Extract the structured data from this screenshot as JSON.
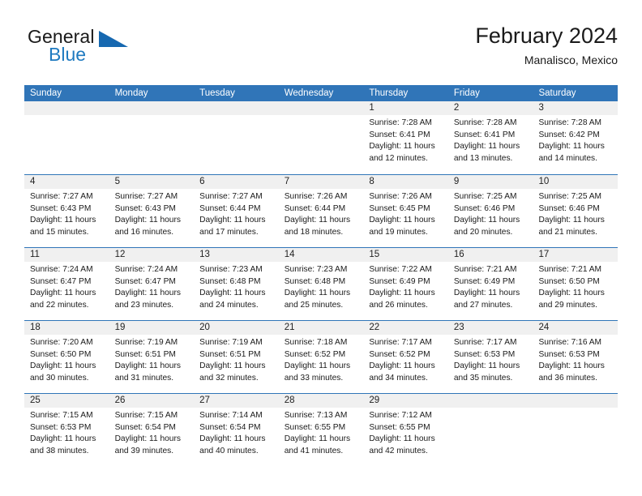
{
  "brand": {
    "name_top": "General",
    "name_bottom": "Blue",
    "triangle_color": "#1668b0",
    "blue_text_color": "#1f7ac0"
  },
  "header": {
    "title": "February 2024",
    "subtitle": "Manalisco, Mexico"
  },
  "theme": {
    "header_blue": "#3075b8",
    "day_band_gray": "#f0f0f0",
    "row_divider_blue": "#3075b8",
    "text_color": "#1a1a1a"
  },
  "weekdays": [
    "Sunday",
    "Monday",
    "Tuesday",
    "Wednesday",
    "Thursday",
    "Friday",
    "Saturday"
  ],
  "weeks": [
    [
      {
        "day": "",
        "empty": true
      },
      {
        "day": "",
        "empty": true
      },
      {
        "day": "",
        "empty": true
      },
      {
        "day": "",
        "empty": true
      },
      {
        "day": "1",
        "sunrise": "Sunrise: 7:28 AM",
        "sunset": "Sunset: 6:41 PM",
        "daylight_1": "Daylight: 11 hours",
        "daylight_2": "and 12 minutes."
      },
      {
        "day": "2",
        "sunrise": "Sunrise: 7:28 AM",
        "sunset": "Sunset: 6:41 PM",
        "daylight_1": "Daylight: 11 hours",
        "daylight_2": "and 13 minutes."
      },
      {
        "day": "3",
        "sunrise": "Sunrise: 7:28 AM",
        "sunset": "Sunset: 6:42 PM",
        "daylight_1": "Daylight: 11 hours",
        "daylight_2": "and 14 minutes."
      }
    ],
    [
      {
        "day": "4",
        "sunrise": "Sunrise: 7:27 AM",
        "sunset": "Sunset: 6:43 PM",
        "daylight_1": "Daylight: 11 hours",
        "daylight_2": "and 15 minutes."
      },
      {
        "day": "5",
        "sunrise": "Sunrise: 7:27 AM",
        "sunset": "Sunset: 6:43 PM",
        "daylight_1": "Daylight: 11 hours",
        "daylight_2": "and 16 minutes."
      },
      {
        "day": "6",
        "sunrise": "Sunrise: 7:27 AM",
        "sunset": "Sunset: 6:44 PM",
        "daylight_1": "Daylight: 11 hours",
        "daylight_2": "and 17 minutes."
      },
      {
        "day": "7",
        "sunrise": "Sunrise: 7:26 AM",
        "sunset": "Sunset: 6:44 PM",
        "daylight_1": "Daylight: 11 hours",
        "daylight_2": "and 18 minutes."
      },
      {
        "day": "8",
        "sunrise": "Sunrise: 7:26 AM",
        "sunset": "Sunset: 6:45 PM",
        "daylight_1": "Daylight: 11 hours",
        "daylight_2": "and 19 minutes."
      },
      {
        "day": "9",
        "sunrise": "Sunrise: 7:25 AM",
        "sunset": "Sunset: 6:46 PM",
        "daylight_1": "Daylight: 11 hours",
        "daylight_2": "and 20 minutes."
      },
      {
        "day": "10",
        "sunrise": "Sunrise: 7:25 AM",
        "sunset": "Sunset: 6:46 PM",
        "daylight_1": "Daylight: 11 hours",
        "daylight_2": "and 21 minutes."
      }
    ],
    [
      {
        "day": "11",
        "sunrise": "Sunrise: 7:24 AM",
        "sunset": "Sunset: 6:47 PM",
        "daylight_1": "Daylight: 11 hours",
        "daylight_2": "and 22 minutes."
      },
      {
        "day": "12",
        "sunrise": "Sunrise: 7:24 AM",
        "sunset": "Sunset: 6:47 PM",
        "daylight_1": "Daylight: 11 hours",
        "daylight_2": "and 23 minutes."
      },
      {
        "day": "13",
        "sunrise": "Sunrise: 7:23 AM",
        "sunset": "Sunset: 6:48 PM",
        "daylight_1": "Daylight: 11 hours",
        "daylight_2": "and 24 minutes."
      },
      {
        "day": "14",
        "sunrise": "Sunrise: 7:23 AM",
        "sunset": "Sunset: 6:48 PM",
        "daylight_1": "Daylight: 11 hours",
        "daylight_2": "and 25 minutes."
      },
      {
        "day": "15",
        "sunrise": "Sunrise: 7:22 AM",
        "sunset": "Sunset: 6:49 PM",
        "daylight_1": "Daylight: 11 hours",
        "daylight_2": "and 26 minutes."
      },
      {
        "day": "16",
        "sunrise": "Sunrise: 7:21 AM",
        "sunset": "Sunset: 6:49 PM",
        "daylight_1": "Daylight: 11 hours",
        "daylight_2": "and 27 minutes."
      },
      {
        "day": "17",
        "sunrise": "Sunrise: 7:21 AM",
        "sunset": "Sunset: 6:50 PM",
        "daylight_1": "Daylight: 11 hours",
        "daylight_2": "and 29 minutes."
      }
    ],
    [
      {
        "day": "18",
        "sunrise": "Sunrise: 7:20 AM",
        "sunset": "Sunset: 6:50 PM",
        "daylight_1": "Daylight: 11 hours",
        "daylight_2": "and 30 minutes."
      },
      {
        "day": "19",
        "sunrise": "Sunrise: 7:19 AM",
        "sunset": "Sunset: 6:51 PM",
        "daylight_1": "Daylight: 11 hours",
        "daylight_2": "and 31 minutes."
      },
      {
        "day": "20",
        "sunrise": "Sunrise: 7:19 AM",
        "sunset": "Sunset: 6:51 PM",
        "daylight_1": "Daylight: 11 hours",
        "daylight_2": "and 32 minutes."
      },
      {
        "day": "21",
        "sunrise": "Sunrise: 7:18 AM",
        "sunset": "Sunset: 6:52 PM",
        "daylight_1": "Daylight: 11 hours",
        "daylight_2": "and 33 minutes."
      },
      {
        "day": "22",
        "sunrise": "Sunrise: 7:17 AM",
        "sunset": "Sunset: 6:52 PM",
        "daylight_1": "Daylight: 11 hours",
        "daylight_2": "and 34 minutes."
      },
      {
        "day": "23",
        "sunrise": "Sunrise: 7:17 AM",
        "sunset": "Sunset: 6:53 PM",
        "daylight_1": "Daylight: 11 hours",
        "daylight_2": "and 35 minutes."
      },
      {
        "day": "24",
        "sunrise": "Sunrise: 7:16 AM",
        "sunset": "Sunset: 6:53 PM",
        "daylight_1": "Daylight: 11 hours",
        "daylight_2": "and 36 minutes."
      }
    ],
    [
      {
        "day": "25",
        "sunrise": "Sunrise: 7:15 AM",
        "sunset": "Sunset: 6:53 PM",
        "daylight_1": "Daylight: 11 hours",
        "daylight_2": "and 38 minutes."
      },
      {
        "day": "26",
        "sunrise": "Sunrise: 7:15 AM",
        "sunset": "Sunset: 6:54 PM",
        "daylight_1": "Daylight: 11 hours",
        "daylight_2": "and 39 minutes."
      },
      {
        "day": "27",
        "sunrise": "Sunrise: 7:14 AM",
        "sunset": "Sunset: 6:54 PM",
        "daylight_1": "Daylight: 11 hours",
        "daylight_2": "and 40 minutes."
      },
      {
        "day": "28",
        "sunrise": "Sunrise: 7:13 AM",
        "sunset": "Sunset: 6:55 PM",
        "daylight_1": "Daylight: 11 hours",
        "daylight_2": "and 41 minutes."
      },
      {
        "day": "29",
        "sunrise": "Sunrise: 7:12 AM",
        "sunset": "Sunset: 6:55 PM",
        "daylight_1": "Daylight: 11 hours",
        "daylight_2": "and 42 minutes."
      },
      {
        "day": "",
        "empty": true
      },
      {
        "day": "",
        "empty": true
      }
    ]
  ]
}
